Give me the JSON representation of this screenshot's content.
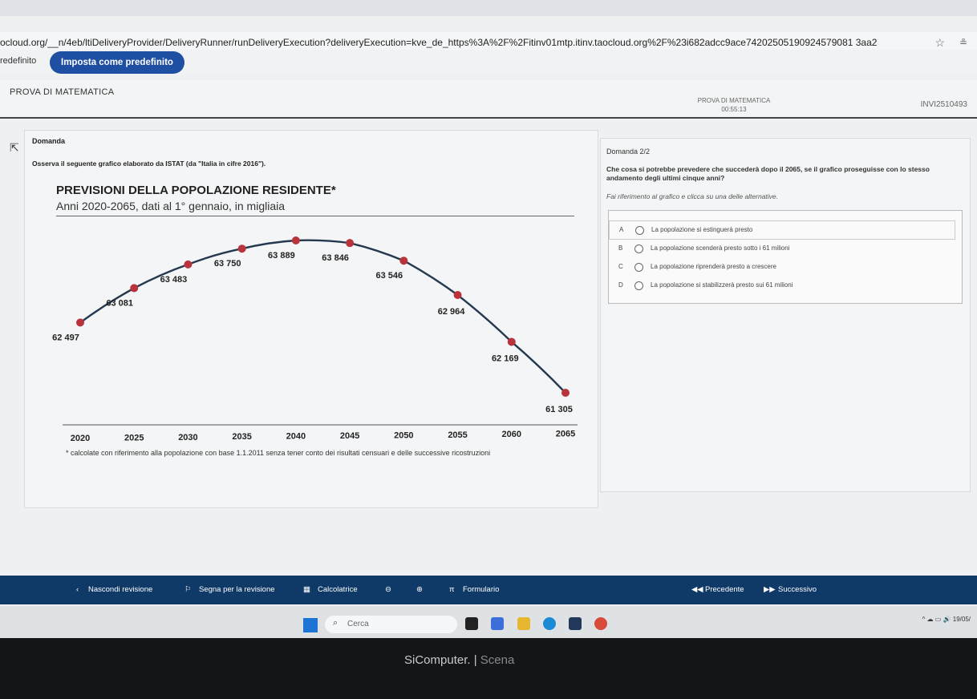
{
  "browser": {
    "url": "ocloud.org/__n/4eb/ltiDeliveryProvider/DeliveryRunner/runDeliveryExecution?deliveryExecution=kve_de_https%3A%2F%2Fitinv01mtp.itinv.taocloud.org%2F%23i682adcc9ace74202505190924579081 3aa2",
    "infobar_label": "redefinito",
    "infobar_button": "Imposta come predefinito",
    "star_icon": "☆",
    "profile_icon": "≗"
  },
  "app": {
    "title": "PROVA DI MATEMATICA",
    "center_title": "PROVA DI MATEMATICA",
    "timer": "00:55:13",
    "user": "INVI2510493"
  },
  "left": {
    "label": "Domanda",
    "question": "Osserva il seguente grafico elaborato da ISTAT (da \"Italia in cifre 2016\").",
    "footnote": "* calcolate con riferimento alla popolazione con base 1.1.2011 senza tener conto dei risultati censuari e delle successive ricostruzioni"
  },
  "chart_data": {
    "type": "line",
    "title": "PREVISIONI DELLA POPOLAZIONE RESIDENTE*",
    "subtitle": "Anni 2020-2065, dati al 1° gennaio, in migliaia",
    "categories": [
      "2020",
      "2025",
      "2030",
      "2035",
      "2040",
      "2045",
      "2050",
      "2055",
      "2060",
      "2065"
    ],
    "values": [
      62497,
      63081,
      63483,
      63750,
      63889,
      63846,
      63546,
      62964,
      62169,
      61305
    ],
    "labels": [
      "62 497",
      "63 081",
      "63 483",
      "63 750",
      "63 889",
      "63 846",
      "63 546",
      "62 964",
      "62 169",
      "61 305"
    ],
    "ylim": [
      61305,
      63889
    ],
    "grid": false,
    "line_color": "#24384f",
    "point_color": "#b8333b"
  },
  "right": {
    "number": "Domanda 2/2",
    "question": "Che cosa si potrebbe prevedere che succederà dopo il 2065, se il grafico proseguisse con lo stesso andamento degli ultimi cinque anni?",
    "instruction": "Fai riferimento al grafico e clicca su una delle alternative.",
    "options": [
      {
        "letter": "A",
        "text": "La popolazione si estinguerà presto"
      },
      {
        "letter": "B",
        "text": "La popolazione scenderà presto sotto i 61 milioni"
      },
      {
        "letter": "C",
        "text": "La popolazione riprenderà presto a crescere"
      },
      {
        "letter": "D",
        "text": "La popolazione si stabilizzerà presto sui 61 milioni"
      }
    ]
  },
  "bottom": {
    "hide_review": "Nascondi revisione",
    "flag": "Segna per la revisione",
    "calculator": "Calcolatrice",
    "formulas": "Formulario",
    "previous": "Precedente",
    "next": "Successivo",
    "chevron_left_icon": "‹",
    "flag_icon": "⚐",
    "calc_icon": "▦",
    "pi_icon": "π",
    "prev_icon": "◀◀",
    "next_icon": "▶▶",
    "zoom_out_icon": "⊖",
    "zoom_in_icon": "⊕"
  },
  "taskbar": {
    "search": "Cerca",
    "search_icon": "⌕",
    "date": "19/05/",
    "tray_icons": "^  ☁  ▭  🔊"
  },
  "monitor": {
    "brand": "SiComputer.",
    "sub": "Scena"
  }
}
